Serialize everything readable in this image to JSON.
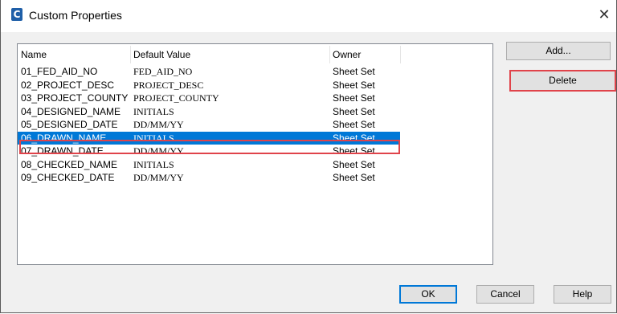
{
  "window": {
    "icon_glyph": "C",
    "icon": "app-icon",
    "title": "Custom Properties",
    "close_glyph": "✕"
  },
  "list": {
    "columns": [
      "Name",
      "Default Value",
      "Owner"
    ],
    "rows": [
      {
        "name": "01_FED_AID_NO",
        "default": "FED_AID_NO",
        "owner": "Sheet Set"
      },
      {
        "name": "02_PROJECT_DESC",
        "default": "PROJECT_DESC",
        "owner": "Sheet Set"
      },
      {
        "name": "03_PROJECT_COUNTY",
        "default": "PROJECT_COUNTY",
        "owner": "Sheet Set"
      },
      {
        "name": "04_DESIGNED_NAME",
        "default": "INITIALS",
        "owner": "Sheet Set"
      },
      {
        "name": "05_DESIGNED_DATE",
        "default": "DD/MM/YY",
        "owner": "Sheet Set"
      },
      {
        "name": "06_DRAWN_NAME",
        "default": "INITIALS",
        "owner": "Sheet Set",
        "selected": true
      },
      {
        "name": "07_DRAWN_DATE",
        "default": "DD/MM/YY",
        "owner": "Sheet Set"
      },
      {
        "name": "08_CHECKED_NAME",
        "default": "INITIALS",
        "owner": "Sheet Set"
      },
      {
        "name": "09_CHECKED_DATE",
        "default": "DD/MM/YY",
        "owner": "Sheet Set"
      }
    ]
  },
  "buttons": {
    "add": "Add...",
    "delete": "Delete",
    "ok": "OK",
    "cancel": "Cancel",
    "help": "Help"
  },
  "colors": {
    "selection": "#0078d7",
    "highlight_outline": "#e0434a"
  }
}
